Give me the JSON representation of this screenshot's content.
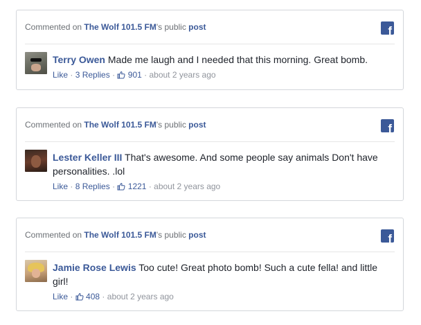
{
  "cards": [
    {
      "header": {
        "prefix": "Commented on ",
        "page": "The Wolf 101.5 FM",
        "suffix": "'s public ",
        "post": "post"
      },
      "author": "Terry Owen",
      "text": "Made me laugh and I needed that this morning. Great bomb.",
      "like": "Like",
      "replies": "3 Replies",
      "likes": "901",
      "time": "about 2 years ago"
    },
    {
      "header": {
        "prefix": "Commented on ",
        "page": "The Wolf 101.5 FM",
        "suffix": "'s public ",
        "post": "post"
      },
      "author": "Lester Keller III",
      "text": "That's awesome. And some people say animals Don't have personalities. .lol",
      "like": "Like",
      "replies": "8 Replies",
      "likes": "1221",
      "time": "about 2 years ago"
    },
    {
      "header": {
        "prefix": "Commented on ",
        "page": "The Wolf 101.5 FM",
        "suffix": "'s public ",
        "post": "post"
      },
      "author": "Jamie Rose Lewis",
      "text": "Too cute! Great photo bomb! Such a cute fella! and little girl!",
      "like": "Like",
      "likes": "408",
      "time": "about 2 years ago"
    }
  ],
  "separator": "·",
  "icons": {
    "facebook": "facebook-icon",
    "thumb": "thumbs-up-icon"
  },
  "colors": {
    "link": "#3b5998",
    "meta": "#90949c",
    "border": "#d3d6db"
  }
}
